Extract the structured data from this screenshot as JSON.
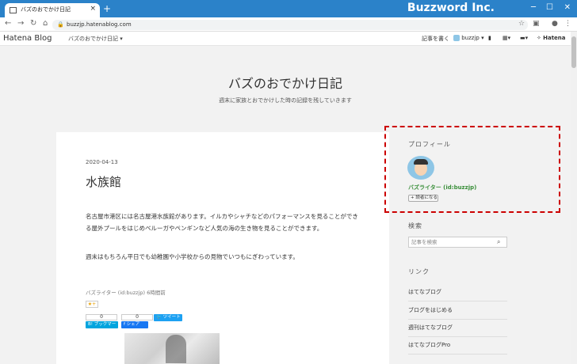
{
  "browser": {
    "tab_title": "バズのおでかけ日記",
    "tab_close": "×",
    "new_tab": "+",
    "brand": "Buzzword Inc.",
    "url": "buzzjp.hatenablog.com"
  },
  "hatena_bar": {
    "logo": "Hatena Blog",
    "blog_name": "バズのおでかけ日記 ▾",
    "write": "記事を書く",
    "user": "buzzjp ▾",
    "hatena": "Hatena"
  },
  "blog": {
    "title": "バズのおでかけ日記",
    "description": "週末に家族とおでかけした時の記録を残していきます"
  },
  "article": {
    "date": "2020-04-13",
    "title": "水族館",
    "paragraph1": "名古屋市港区には名古屋港水族館があります。イルカやシャチなどのパフォーマンスを見ることができる屋外プールをはじめベルーガやペンギンなど人気の海の生き物を見ることができます。",
    "paragraph2": "週末はもちろん平日でも幼稚園や小学校からの見物でいつもにぎわっています。",
    "author": "バズライター (id:buzzjp) 6時間前",
    "star": "★+",
    "bookmark_count": "0",
    "share_count": "0",
    "bookmark_label": "B! ブックマーク",
    "share_label": "f シェア",
    "tweet_label": "ツイート"
  },
  "sidebar": {
    "profile_heading": "プロフィール",
    "profile_name": "バズライター (id:buzzjp)",
    "reader_button": "+ 読者になる",
    "search_heading": "検索",
    "search_placeholder": "記事を検索",
    "links_heading": "リンク",
    "links": [
      "はてなブログ",
      "ブログをはじめる",
      "週刊はてなブログ",
      "はてなブログPro"
    ]
  }
}
